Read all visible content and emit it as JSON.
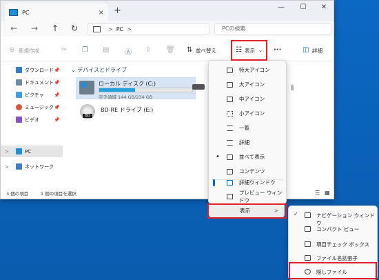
{
  "window": {
    "tab_title": "PC",
    "tab_close": "×",
    "new_tab": "+",
    "controls": {
      "minimize": "—",
      "maximize": "☐",
      "close": "✕"
    }
  },
  "nav": {
    "back": "←",
    "forward": "→",
    "up": "↑",
    "refresh": "↻",
    "address": "PC",
    "address_chevron": ">",
    "search_placeholder": "PCの検索"
  },
  "toolbar": {
    "new_label": "新規作成",
    "sort_label": "並べ替え",
    "view_label": "表示",
    "more": "···",
    "details_label": "詳細"
  },
  "sidebar": {
    "items": [
      {
        "label": "ダウンロード",
        "pinned": true,
        "color": "#2f7dd1"
      },
      {
        "label": "ドキュメント",
        "pinned": true,
        "color": "#6b8aa8"
      },
      {
        "label": "ピクチャ",
        "pinned": true,
        "color": "#3aa0e0"
      },
      {
        "label": "ミュージック",
        "pinned": true,
        "color": "#e0533a"
      },
      {
        "label": "ビデオ",
        "pinned": true,
        "color": "#8a4fc8"
      },
      {
        "label": "PC",
        "pinned": false,
        "color": "#1e90d8"
      },
      {
        "label": "ネットワーク",
        "pinned": false,
        "color": "#3a7fd0"
      }
    ]
  },
  "content": {
    "group_header": "デバイスとドライブ",
    "drive_c": {
      "name": "ローカル ディスク (C:)",
      "free_text": "空き領域 144 GB/234 GB",
      "used_fraction": 0.385
    },
    "drive_e": {
      "name": "BD-RE ドライブ (E:)",
      "icon_label": "BD"
    }
  },
  "status": {
    "count": "3 個の項目",
    "selection": "1 個の項目を選択"
  },
  "view_menu": {
    "items": [
      {
        "label": "特大アイコン",
        "state": ""
      },
      {
        "label": "大アイコン",
        "state": ""
      },
      {
        "label": "中アイコン",
        "state": ""
      },
      {
        "label": "小アイコン",
        "state": ""
      },
      {
        "label": "一覧",
        "state": ""
      },
      {
        "label": "詳細",
        "state": ""
      },
      {
        "label": "並べて表示",
        "state": "•"
      },
      {
        "label": "コンテンツ",
        "state": ""
      },
      {
        "label": "詳細ウィンドウ",
        "state": "active"
      },
      {
        "label": "プレビュー ウィンドウ",
        "state": ""
      }
    ],
    "show_label": "表示",
    "show_arrow": ">"
  },
  "show_submenu": {
    "items": [
      {
        "label": "ナビゲーション ウィンドウ",
        "checked": "✓"
      },
      {
        "label": "コンパクト ビュー",
        "checked": ""
      },
      {
        "label": "項目チェック ボックス",
        "checked": ""
      },
      {
        "label": "ファイル名拡張子",
        "checked": ""
      },
      {
        "label": "隠しファイル",
        "checked": ""
      }
    ]
  },
  "colors": {
    "desktop": "#0a63b8",
    "accent": "#0067c0",
    "highlight_box": "#e0202a",
    "selection": "#d6e4f3"
  }
}
